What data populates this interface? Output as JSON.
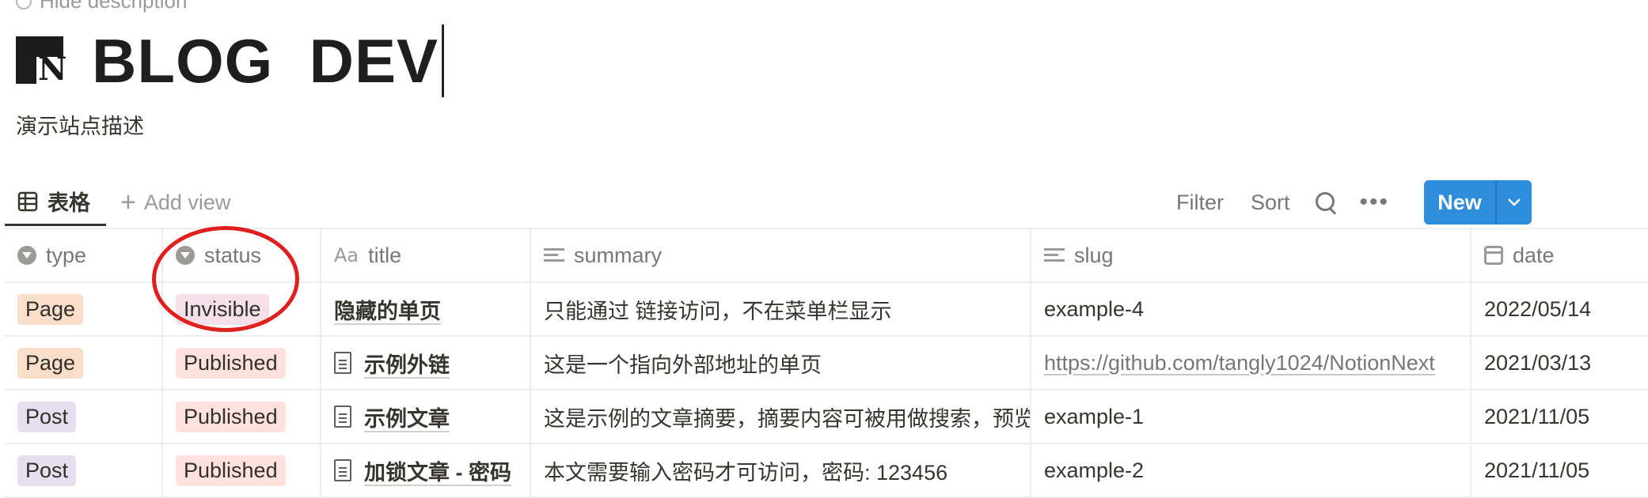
{
  "page": {
    "hide_description": "Hide description",
    "title": "BLOG  DEV",
    "description": "演示站点描述"
  },
  "views": {
    "active_tab": "表格",
    "add_view": "Add view"
  },
  "toolbar": {
    "filter": "Filter",
    "sort": "Sort",
    "more": "•••",
    "new": "New"
  },
  "table": {
    "columns": [
      {
        "label": "type",
        "icon": "select-icon"
      },
      {
        "label": "status",
        "icon": "select-icon"
      },
      {
        "label": "title",
        "icon": "text-aa-icon"
      },
      {
        "label": "summary",
        "icon": "text-lines-icon"
      },
      {
        "label": "slug",
        "icon": "text-lines-icon"
      },
      {
        "label": "date",
        "icon": "calendar-icon"
      }
    ],
    "rows": [
      {
        "type": "Page",
        "status": "Invisible",
        "title": "隐藏的单页",
        "summary": "只能通过 链接访问，不在菜单栏显示",
        "slug": "example-4",
        "date": "2022/05/14"
      },
      {
        "type": "Page",
        "status": "Published",
        "title": "示例外链",
        "summary": "这是一个指向外部地址的单页",
        "slug": "https://github.com/tangly1024/NotionNext",
        "date": "2021/03/13"
      },
      {
        "type": "Post",
        "status": "Published",
        "title": "示例文章",
        "summary": "这是示例的文章摘要，摘要内容可被用做搜索，预览",
        "slug": "example-1",
        "date": "2021/11/05"
      },
      {
        "type": "Post",
        "status": "Published",
        "title": "加锁文章 - 密码",
        "summary": "本文需要输入密码才可访问，密码: 123456",
        "slug": "example-2",
        "date": "2021/11/05"
      }
    ]
  },
  "colors": {
    "accent": "#2e8ddc",
    "annotation": "#e01f1f",
    "tag_page": "#fadec9",
    "tag_post": "#e8deee",
    "tag_invisible": "#f5e0e9",
    "tag_published": "#ffe2dd"
  }
}
